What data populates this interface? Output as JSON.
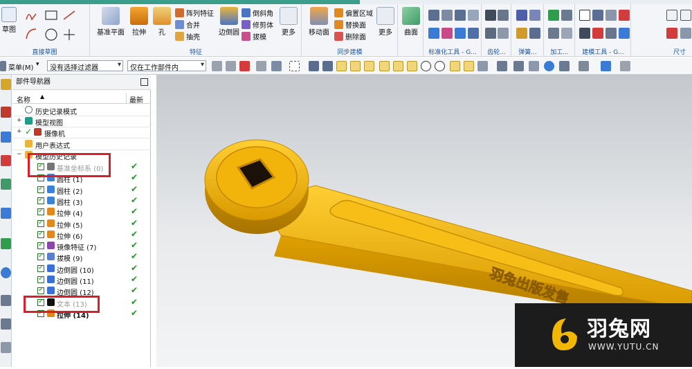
{
  "ribbon": {
    "direct_sketch": {
      "label": "直接草图",
      "sketch_btn": "草图"
    },
    "feature": {
      "label": "特征",
      "datum_plane": "基准平面",
      "extrude": "拉伸",
      "hole": "孔",
      "array_feature": "阵列特征",
      "unite": "合并",
      "shell": "抽壳",
      "edge_blend": "边倒圆",
      "chamfer": "倒斜角",
      "trim_body": "修剪体",
      "draft": "拔模",
      "more": "更多"
    },
    "sync_modeling": {
      "label": "同步建模",
      "move_face": "移动面",
      "offset_region": "偏置区域",
      "replace_face": "替换面",
      "delete_face": "删除面",
      "more": "更多"
    },
    "surface": {
      "surface_btn": "曲面"
    },
    "groups": [
      "标准化工具 - G...",
      "齿轮...",
      "弹簧...",
      "加工...",
      "建模工具 - G...",
      "尺寸"
    ]
  },
  "toolbar2": {
    "menu": "菜单(M)",
    "filter": "没有选择过滤器",
    "scope": "仅在工作部件内"
  },
  "navigator": {
    "title": "部件导航器",
    "col_name": "名称",
    "col_latest": "最新",
    "top_items": [
      {
        "label": "历史记录模式",
        "icon_color": "#6b7280"
      },
      {
        "label": "模型视图",
        "icon_color": "#1e9e8a"
      },
      {
        "label": "摄像机",
        "icon_color": "#c0392b"
      },
      {
        "label": "用户表达式",
        "icon_color": "#d9a21b"
      }
    ],
    "history_header": "模型历史记录",
    "features": [
      {
        "label": "基准坐标系 (0)",
        "style": "grey",
        "icon_color": "#777777"
      },
      {
        "label": "圆柱 (1)",
        "style": "normal",
        "icon_color": "#3b82d6"
      },
      {
        "label": "圆柱 (2)",
        "style": "normal",
        "icon_color": "#3b82d6"
      },
      {
        "label": "圆柱 (3)",
        "style": "normal",
        "icon_color": "#3b82d6"
      },
      {
        "label": "拉伸 (4)",
        "style": "normal",
        "icon_color": "#e0891e"
      },
      {
        "label": "拉伸 (5)",
        "style": "normal",
        "icon_color": "#e0891e"
      },
      {
        "label": "拉伸 (6)",
        "style": "normal",
        "icon_color": "#e0891e"
      },
      {
        "label": "镜像特征 (7)",
        "style": "normal",
        "icon_color": "#8e44ad"
      },
      {
        "label": "拔模 (9)",
        "style": "normal",
        "icon_color": "#5a7fd0"
      },
      {
        "label": "边倒圆 (10)",
        "style": "normal",
        "icon_color": "#3b6fd6"
      },
      {
        "label": "边倒圆 (11)",
        "style": "normal",
        "icon_color": "#3b6fd6"
      },
      {
        "label": "边倒圆 (12)",
        "style": "normal",
        "icon_color": "#3b6fd6"
      },
      {
        "label": "文本 (13)",
        "style": "grey",
        "icon_color": "#111111"
      },
      {
        "label": "拉伸 (14)",
        "style": "bold",
        "icon_color": "#e0891e"
      }
    ]
  },
  "model": {
    "engraved_text": "羽兔出版发售"
  },
  "watermark": {
    "name": "羽兔网",
    "url": "WWW.YUTU.CN"
  },
  "colors": {
    "accent": "#1d56a0",
    "model_yellow": "#f2b705",
    "highlight_red": "#d8202a",
    "check_green": "#1a9a1a"
  }
}
